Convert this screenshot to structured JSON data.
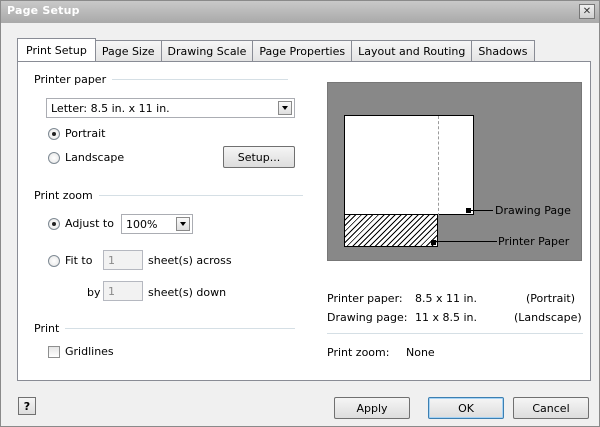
{
  "window": {
    "title": "Page Setup",
    "close_glyph": "✕"
  },
  "tabs": [
    {
      "label": "Print Setup",
      "active": true
    },
    {
      "label": "Page Size"
    },
    {
      "label": "Drawing Scale"
    },
    {
      "label": "Page Properties"
    },
    {
      "label": "Layout and Routing"
    },
    {
      "label": "Shadows"
    }
  ],
  "printer_paper": {
    "heading": "Printer paper",
    "selected": "Letter:  8.5 in. x 11 in.",
    "orientation": {
      "portrait_label": "Portrait",
      "landscape_label": "Landscape",
      "selected": "Portrait"
    },
    "setup_button": "Setup..."
  },
  "print_zoom": {
    "heading": "Print zoom",
    "adjust_label": "Adjust to",
    "adjust_value": "100%",
    "fit_label": "Fit to",
    "sheets_across_value": "1",
    "sheets_across_label": "sheet(s) across",
    "by_label": "by",
    "sheets_down_value": "1",
    "sheets_down_label": "sheet(s) down",
    "selected": "Adjust to"
  },
  "print": {
    "heading": "Print",
    "gridlines_label": "Gridlines",
    "gridlines_checked": false
  },
  "preview": {
    "drawing_page_callout": "Drawing Page",
    "printer_paper_callout": "Printer Paper",
    "background_color": "#888888"
  },
  "info": {
    "printer_paper_label": "Printer paper:",
    "printer_paper_value": "8.5 x 11 in.",
    "printer_paper_orientation": "(Portrait)",
    "drawing_page_label": "Drawing page:",
    "drawing_page_value": "11 x 8.5 in.",
    "drawing_page_orientation": "(Landscape)",
    "print_zoom_label": "Print zoom:",
    "print_zoom_value": "None"
  },
  "footer": {
    "help_glyph": "?",
    "apply_button": "Apply",
    "ok_button": "OK",
    "cancel_button": "Cancel"
  }
}
